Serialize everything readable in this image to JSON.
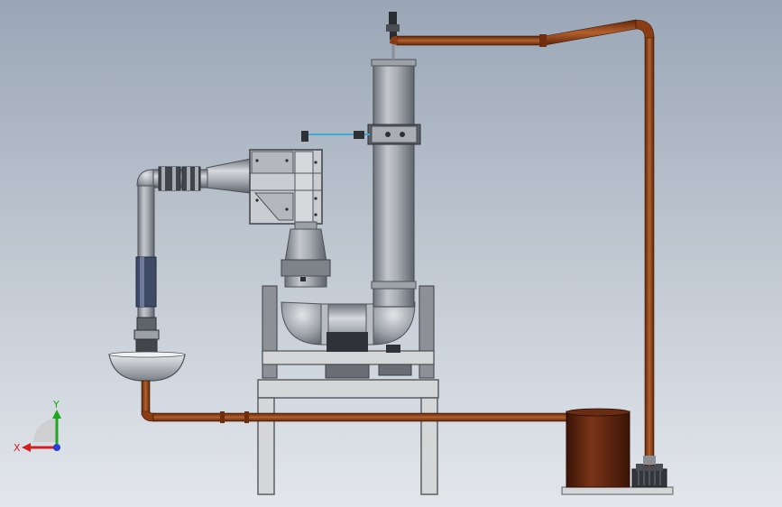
{
  "viewport": {
    "background_top": "#9aa6b6",
    "background_bottom": "#e3e7ec"
  },
  "triad": {
    "x_label": "X",
    "y_label": "Y",
    "x_color": "#d42020",
    "y_color": "#1fa61f",
    "z_color": "#2a3fd8"
  },
  "colors": {
    "copper_pipe": "#8a3c14",
    "steel": "#9aa0a8",
    "frame_fill": "#d4d6d8",
    "tank": "#5a2410",
    "tube_blue": "#3fa9d6"
  }
}
